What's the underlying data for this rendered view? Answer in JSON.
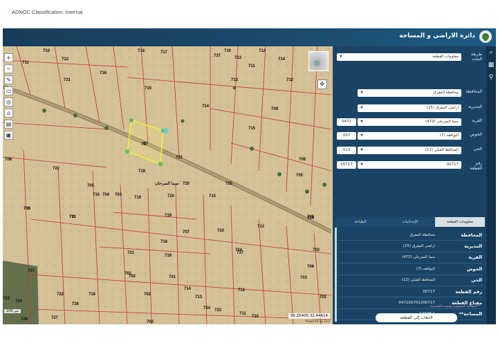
{
  "classification": "ADNOC Classification: Internal",
  "app": {
    "title": "دائرة الاراضي و المساحة"
  },
  "map": {
    "scale": "100 متر",
    "coords": "36.25405,32.44614",
    "attribution": "Powered by Esri",
    "parcels": [
      {
        "n": "710"
      },
      {
        "n": "722"
      },
      {
        "n": "711"
      },
      {
        "n": "721"
      },
      {
        "n": "716"
      },
      {
        "n": "718"
      },
      {
        "n": "717"
      },
      {
        "n": "715"
      },
      {
        "n": "737"
      },
      {
        "n": "713"
      },
      {
        "n": "712"
      },
      {
        "n": "714"
      },
      {
        "n": "710"
      },
      {
        "n": "711"
      },
      {
        "n": "712"
      },
      {
        "n": "713"
      },
      {
        "n": "714"
      },
      {
        "n": "715"
      },
      {
        "n": "708"
      },
      {
        "n": "709"
      },
      {
        "n": "706"
      },
      {
        "n": "705"
      },
      {
        "n": "704"
      },
      {
        "n": "702"
      },
      {
        "n": "722"
      },
      {
        "n": "716"
      },
      {
        "n": "711"
      },
      {
        "n": "717"
      },
      {
        "n": "718"
      },
      {
        "n": "721"
      },
      {
        "n": "720"
      },
      {
        "n": "720"
      },
      {
        "n": "719"
      },
      {
        "n": "705"
      },
      {
        "n": "704"
      },
      {
        "n": "703"
      },
      {
        "n": "736"
      },
      {
        "n": "715"
      },
      {
        "n": "725"
      },
      {
        "n": "719"
      },
      {
        "n": "736"
      },
      {
        "n": "731"
      },
      {
        "n": "720"
      },
      {
        "n": "707"
      },
      {
        "n": "718"
      },
      {
        "n": "721"
      },
      {
        "n": "719"
      },
      {
        "n": "712"
      },
      {
        "n": "704"
      },
      {
        "n": "702"
      },
      {
        "n": "706"
      },
      {
        "n": "737"
      },
      {
        "n": "722"
      },
      {
        "n": "716"
      },
      {
        "n": "702"
      },
      {
        "n": "714"
      },
      {
        "n": "713"
      },
      {
        "n": "724"
      },
      {
        "n": "712"
      },
      {
        "n": "723"
      },
      {
        "n": "711"
      },
      {
        "n": "710"
      },
      {
        "n": "728"
      },
      {
        "n": "727"
      },
      {
        "n": "726"
      },
      {
        "n": "702"
      },
      {
        "n": "702"
      },
      {
        "n": "701"
      },
      {
        "n": "703"
      },
      {
        "n": "737"
      },
      {
        "n": "702"
      },
      {
        "n": "722"
      },
      {
        "n": "724"
      },
      {
        "n": "706"
      }
    ],
    "village_label": "سما السرحان"
  },
  "panel": {
    "search_by_label": "طريقة البحث",
    "search_by_value": "معلومات القطعة",
    "fields": [
      {
        "label": "المحافظة",
        "value": "محافظة المفرق",
        "code": ""
      },
      {
        "label": "المديرية",
        "value": "اراضي المفرق (25)",
        "code": ""
      },
      {
        "label": "القرية",
        "value": "سما السرحان (472)",
        "code": "0472"
      },
      {
        "label": "الحوض",
        "value": "البوافقه (7)",
        "code": "007"
      },
      {
        "label": "الحي",
        "value": "المحافظ القبلي (12)",
        "code": "012"
      },
      {
        "label": "رقم القطعة",
        "value": "00717",
        "code": "00717"
      }
    ],
    "tabs": [
      "معلومات القطعة",
      "الإحداثيات",
      "الطباعة"
    ],
    "info": [
      {
        "key": "المحافظة",
        "value": "محافظة المفرق"
      },
      {
        "key": "المديرية",
        "value": "اراضي المفرق (25)"
      },
      {
        "key": "القرية",
        "value": "سما السرحان (472)"
      },
      {
        "key": "الحوض",
        "value": "البوافقه (7)"
      },
      {
        "key": "الحي",
        "value": "المحافظ القبلي (12)"
      },
      {
        "key": "رقم القطعة",
        "value": "00717"
      },
      {
        "key": "مفتاح القطعة",
        "value": "047200701200717"
      },
      {
        "key": "المساحة**",
        "value": "12048.1"
      }
    ],
    "note": "**المساحة المحسوبة وليست القسيمية",
    "go_button": "الذهاب إلى القطعة"
  }
}
